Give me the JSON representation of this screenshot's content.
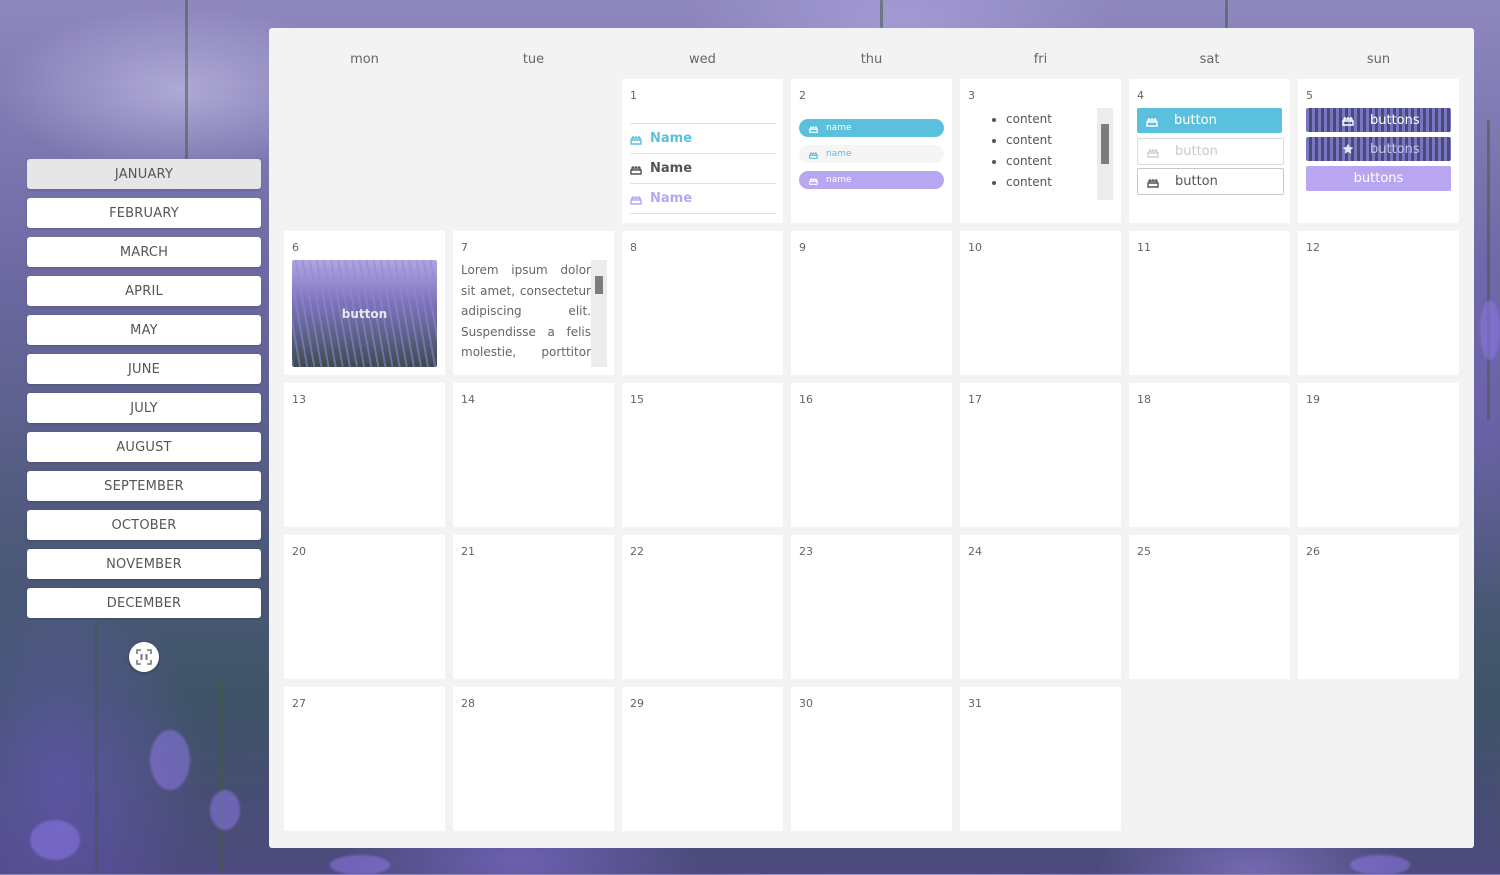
{
  "months": [
    "JANUARY",
    "FEBRUARY",
    "MARCH",
    "APRIL",
    "MAY",
    "JUNE",
    "JULY",
    "AUGUST",
    "SEPTEMBER",
    "OCTOBER",
    "NOVEMBER",
    "DECEMBER"
  ],
  "active_month": "JANUARY",
  "weekdays": [
    "mon",
    "tue",
    "wed",
    "thu",
    "fri",
    "sat",
    "sun"
  ],
  "days": [
    "1",
    "2",
    "3",
    "4",
    "5",
    "6",
    "7",
    "8",
    "9",
    "10",
    "11",
    "12",
    "13",
    "14",
    "15",
    "16",
    "17",
    "18",
    "19",
    "20",
    "21",
    "22",
    "23",
    "24",
    "25",
    "26",
    "27",
    "28",
    "29",
    "30",
    "31"
  ],
  "wed1_names": [
    "Name",
    "Name",
    "Name"
  ],
  "thu2_pills": [
    "name",
    "name",
    "name"
  ],
  "fri3_items": [
    "content",
    "content",
    "content",
    "content"
  ],
  "sat4_buttons": [
    "button",
    "button",
    "button"
  ],
  "sun5_buttons": [
    "buttons",
    "buttons",
    "buttons"
  ],
  "mon6_button": "button",
  "tue7_text": "Lorem ipsum dolor sit amet, consectetur adipiscing elit. Suspendisse a felis molestie, porttitor est",
  "colors": {
    "accent_blue": "#5bc0de",
    "accent_purple": "#b9a6f0",
    "pill_light": "#f5f5f5",
    "panel_bg": "#f3f3f3"
  },
  "icons": {
    "cake": "birthday-cake-icon",
    "star": "star-icon",
    "fab": "scan-icon"
  }
}
